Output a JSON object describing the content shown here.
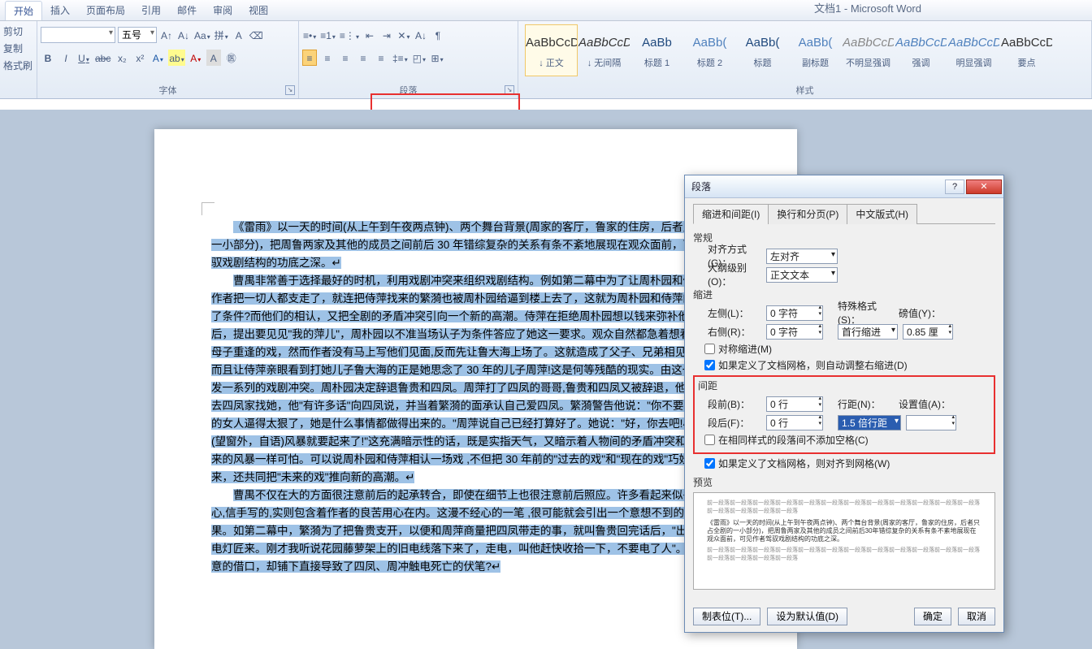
{
  "title_fragment": "文档1 - Microsoft Word",
  "menubar": {
    "items": [
      "开始",
      "插入",
      "页面布局",
      "引用",
      "邮件",
      "审阅",
      "视图"
    ]
  },
  "clipboard": {
    "cut": "剪切",
    "copy": "复制",
    "painter": "格式刷"
  },
  "font": {
    "family": "",
    "size": "五号",
    "bold": "B",
    "italic": "I",
    "under": "U",
    "strike": "abc",
    "sub": "x₂",
    "sup": "x²",
    "label": "字体"
  },
  "paragraph": {
    "label": "段落"
  },
  "styles": {
    "label": "样式",
    "items": [
      {
        "prev": "AaBbCcDd",
        "name": "↓ 正文"
      },
      {
        "prev": "AaBbCcDd",
        "name": "↓ 无间隔"
      },
      {
        "prev": "AaBb",
        "name": "标题 1"
      },
      {
        "prev": "AaBb(",
        "name": "标题 2"
      },
      {
        "prev": "AaBb(",
        "name": "标题"
      },
      {
        "prev": "AaBb(",
        "name": "副标题"
      },
      {
        "prev": "AaBbCcDd",
        "name": "不明显强调"
      },
      {
        "prev": "AaBbCcDd",
        "name": "强调"
      },
      {
        "prev": "AaBbCcDd",
        "name": "明显强调"
      },
      {
        "prev": "AaBbCcDd",
        "name": "要点"
      }
    ]
  },
  "document": {
    "p1": "《雷雨》以一天的时间(从上午到午夜两点钟)、两个舞台背景(周家的客厅，鲁家的住房，后者只占全剧的一小部分)，把周鲁两家及其他的成员之间前后 30 年错综复杂的关系有条不紊地展现在观众面前，可见作者驾驭戏剧结构的功底之深。↵",
    "p2": "曹禺非常善于选择最好的时机，利用戏剧冲突来组织戏剧结构。例如第二幕中为了让周朴园和侍萍相认。作者把一切人都支走了，就连把侍萍找来的繁漪也被周朴园给逼到楼上去了，这就为周朴园和侍萍的相认创造了条件?而他们的相认，又把全剧的矛盾冲突引向一个新的高潮。侍萍在拒绝周朴园想以钱来弥补他的罪过之后，提出要见见\"我的萍儿\"，周朴园以不准当场认子为条件答应了她这一要求。观众自然都急着想看看这一出母子重逢的戏，然而作者没有马上写他们见面,反而先让鲁大海上场了。这就造成了父子、兄弟相见的一幕。而且让侍萍亲眼看到打她儿子鲁大海的正是她思念了 30 年的儿子周萍!这是何等残酷的现实。由这一场戏又引发一系列的戏剧冲突。周朴园决定辞退鲁贵和四凤。周萍打了四凤的哥哥,鲁贵和四凤又被辞退，他决定当晚去四凤家找她，他\"有许多话\"向四凤说，并当着繁漪的面承认自己爱四凤。繁漪警告他说：\"你不要把一个失望的女人逼得太狠了，她是什么事情都做得出来的。\"周萍说自己已经打算好了。她说：\"好，你去吧!小心，现在(望窗外，自语)风暴就要起来了!\"这充满暗示性的话，既是实指天气，又暗示着人物间的矛盾冲突和这即将到来的风暴一样可怕。可以说周朴园和侍萍相认一场戏 ,不但把 30 年前的\"过去的戏\"和\"现在的戏\"巧妙地交织起来，还共同把\"未来的戏\"推向新的高潮。↵",
    "p3": "曹禺不仅在大的方面很注意前后的起承转合，即使在细节上也很注意前后照应。许多看起来似乎是漫不经心,信手写的,实则包含着作者的良苦用心在内。这漫不经心的一笔 ,很可能就会引出一个意想不到的严重的后果。如第二幕中，繁漪为了把鲁贵支开，以便和周萍商量把四凤带走的事，就叫鲁贵回完话后，\"出去叫一个电灯匠来。刚才我听说花园藤萝架上的旧电线落下来了，走电，叫他赶快收拾一下，不要电了人\"。这看似随意的借口，却铺下直接导致了四凤、周冲触电死亡的伏笔?↵"
  },
  "dialog": {
    "title": "段落",
    "tabs": [
      "缩进和间距(I)",
      "换行和分页(P)",
      "中文版式(H)"
    ],
    "general": "常规",
    "align_l": "对齐方式(G)：",
    "align_v": "左对齐",
    "outline_l": "大纲级别(O)：",
    "outline_v": "正文文本",
    "indent": "缩进",
    "left_l": "左侧(L)：",
    "left_v": "0 字符",
    "right_l": "右侧(R)：",
    "right_v": "0 字符",
    "special_l": "特殊格式(S)：",
    "special_v": "首行缩进",
    "by_l": "磅值(Y)：",
    "by_v": "0.85 厘",
    "mirror": "对称缩进(M)",
    "grid_indent": "如果定义了文档网格，则自动调整右缩进(D)",
    "spacing": "间距",
    "before_l": "段前(B)：",
    "before_v": "0 行",
    "after_l": "段后(F)：",
    "after_v": "0 行",
    "line_l": "行距(N)：",
    "line_v": "1.5 倍行距",
    "at_l": "设置值(A)：",
    "at_v": "",
    "nospace": "在相同样式的段落间不添加空格(C)",
    "grid_space": "如果定义了文档网格，则对齐到网格(W)",
    "preview": "预览",
    "prev_grey": "前一段落前一段落前一段落前一段落前一段落前一段落前一段落前一段落前一段落前一段落前一段落前一段落前一段落前一段落前一段落前一段落",
    "prev_sample": "《雷雨》以一天的时间(从上午到午夜两点钟)、两个舞台背景(周家的客厅，鲁家的住房，后者只占全剧的一小部分)，把周鲁两家及其他的成员之间前后30年错综复杂的关系有条不紊地展现在观众面前，可见作者驾驭戏剧结构的功底之深。",
    "tabstops": "制表位(T)...",
    "default": "设为默认值(D)",
    "ok": "确定",
    "cancel": "取消"
  }
}
